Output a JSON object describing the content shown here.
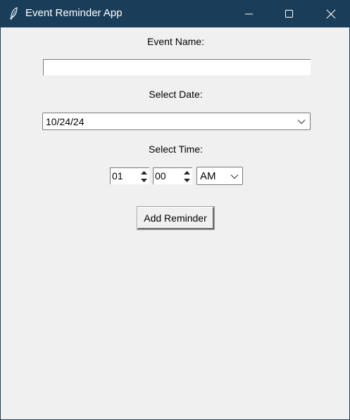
{
  "window": {
    "title": "Event Reminder App",
    "icon": "feather-icon",
    "controls": [
      "minimize-icon",
      "maximize-icon",
      "close-icon"
    ],
    "titlebar_color": "#1a3e5a"
  },
  "form": {
    "event_name_label": "Event Name:",
    "event_name_value": "",
    "date_label": "Select Date:",
    "date_value": "10/24/24",
    "time_label": "Select Time:",
    "hour_value": "01",
    "minute_value": "00",
    "ampm_value": "AM",
    "add_button_label": "Add Reminder"
  }
}
